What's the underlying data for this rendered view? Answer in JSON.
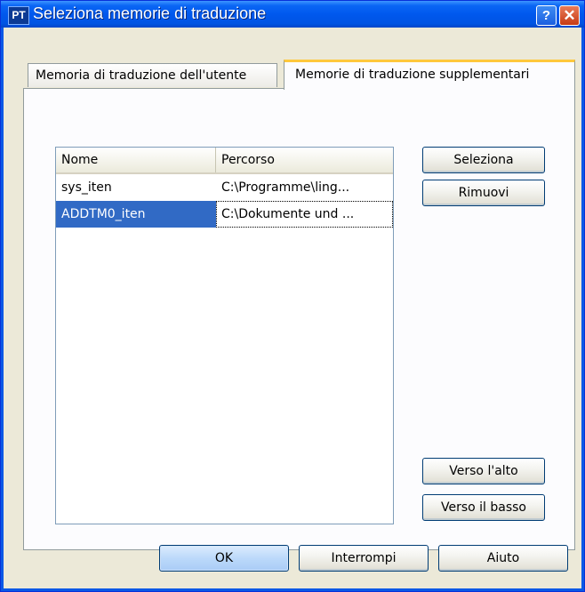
{
  "window": {
    "title": "Seleziona memorie di traduzione",
    "app_icon_label": "PT",
    "help_symbol": "?",
    "close_symbol": "✕"
  },
  "tabs": [
    {
      "label": "Memoria di traduzione dell'utente",
      "active": false
    },
    {
      "label": "Memorie di traduzione supplementari",
      "active": true
    }
  ],
  "list": {
    "columns": [
      "Nome",
      "Percorso"
    ],
    "rows": [
      {
        "name": "sys_iten",
        "path": "C:\\Programme\\ling...",
        "selected": false
      },
      {
        "name": "ADDTM0_iten",
        "path": "C:\\Dokumente und ...",
        "selected": true
      }
    ]
  },
  "side_buttons": {
    "select": "Seleziona",
    "remove": "Rimuovi",
    "move_up": "Verso l'alto",
    "move_down": "Verso il basso"
  },
  "footer_buttons": {
    "ok": "OK",
    "cancel": "Interrompi",
    "help": "Aiuto"
  },
  "colors": {
    "titlebar": "#0058ee",
    "selection": "#316ac5",
    "active_tab_accent": "#ffc83c",
    "dialog_bg": "#ece9d8"
  }
}
